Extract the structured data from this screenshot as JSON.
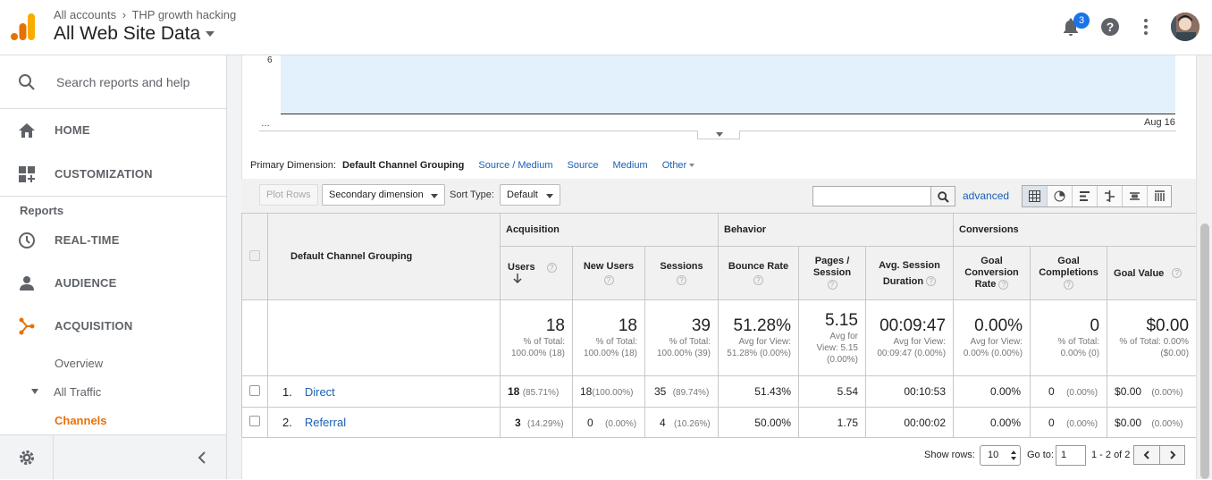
{
  "header": {
    "breadcrumb": [
      "All accounts",
      "THP growth hacking"
    ],
    "breadcrumb_sep": "›",
    "account_view": "All Web Site Data",
    "notifications_count": "3"
  },
  "sidebar": {
    "search_placeholder": "Search reports and help",
    "items": [
      {
        "label": "HOME",
        "icon": "home-icon"
      },
      {
        "label": "CUSTOMIZATION",
        "icon": "dashboard-icon"
      },
      {
        "label": "REAL-TIME",
        "icon": "clock-icon"
      },
      {
        "label": "AUDIENCE",
        "icon": "person-icon"
      },
      {
        "label": "ACQUISITION",
        "icon": "acquisition-icon",
        "active": true
      }
    ],
    "reports_label": "Reports",
    "sub_items": {
      "overview": "Overview",
      "all_traffic": "All Traffic",
      "channels": "Channels"
    },
    "accent_color": "#e8710a"
  },
  "chart": {
    "y_label": "6",
    "x_start": "…",
    "x_end": "Aug 16"
  },
  "primary_dimension": {
    "label": "Primary Dimension:",
    "current": "Default Channel Grouping",
    "options": [
      "Source / Medium",
      "Source",
      "Medium",
      "Other"
    ]
  },
  "toolbar": {
    "plot_rows": "Plot Rows",
    "secondary_dimension": "Secondary dimension",
    "sort_type_label": "Sort Type:",
    "sort_type_value": "Default",
    "search_value": "",
    "advanced": "advanced"
  },
  "table": {
    "groups": {
      "acquisition": "Acquisition",
      "behavior": "Behavior",
      "conversions": "Conversions"
    },
    "dimension_header": "Default Channel Grouping",
    "columns": {
      "users": "Users",
      "new_users": "New Users",
      "sessions": "Sessions",
      "bounce_rate": "Bounce Rate",
      "pages_session": "Pages / Session",
      "avg_session_duration": "Avg. Session Duration",
      "goal_conversion_rate": "Goal Conversion Rate",
      "goal_completions": "Goal Completions",
      "goal_value": "Goal Value"
    },
    "totals": {
      "users": {
        "value": "18",
        "sub": "% of Total: 100.00% (18)"
      },
      "new_users": {
        "value": "18",
        "sub": "% of Total: 100.00% (18)"
      },
      "sessions": {
        "value": "39",
        "sub": "% of Total: 100.00% (39)"
      },
      "bounce_rate": {
        "value": "51.28%",
        "sub": "Avg for View: 51.28% (0.00%)"
      },
      "pages_session": {
        "value": "5.15",
        "sub": "Avg for View: 5.15 (0.00%)"
      },
      "avg_session_duration": {
        "value": "00:09:47",
        "sub": "Avg for View: 00:09:47 (0.00%)"
      },
      "goal_conversion_rate": {
        "value": "0.00%",
        "sub": "Avg for View: 0.00% (0.00%)"
      },
      "goal_completions": {
        "value": "0",
        "sub": "% of Total: 0.00% (0)"
      },
      "goal_value": {
        "value": "$0.00",
        "sub": "% of Total: 0.00% ($0.00)"
      }
    },
    "rows": [
      {
        "index": "1.",
        "channel": "Direct",
        "users": "18",
        "users_pct": "(85.71%)",
        "new_users": "18",
        "new_users_pct": "(100.00%)",
        "sessions": "35",
        "sessions_pct": "(89.74%)",
        "bounce_rate": "51.43%",
        "pages_session": "5.54",
        "avg_session_duration": "00:10:53",
        "goal_conversion_rate": "0.00%",
        "goal_completions": "0",
        "goal_completions_pct": "(0.00%)",
        "goal_value": "$0.00",
        "goal_value_pct": "(0.00%)"
      },
      {
        "index": "2.",
        "channel": "Referral",
        "users": "3",
        "users_pct": "(14.29%)",
        "new_users": "0",
        "new_users_pct": "(0.00%)",
        "sessions": "4",
        "sessions_pct": "(10.26%)",
        "bounce_rate": "50.00%",
        "pages_session": "1.75",
        "avg_session_duration": "00:00:02",
        "goal_conversion_rate": "0.00%",
        "goal_completions": "0",
        "goal_completions_pct": "(0.00%)",
        "goal_value": "$0.00",
        "goal_value_pct": "(0.00%)"
      }
    ]
  },
  "pagination": {
    "show_rows_label": "Show rows:",
    "show_rows_value": "10",
    "goto_label": "Go to:",
    "goto_value": "1",
    "range": "1 - 2 of 2"
  }
}
